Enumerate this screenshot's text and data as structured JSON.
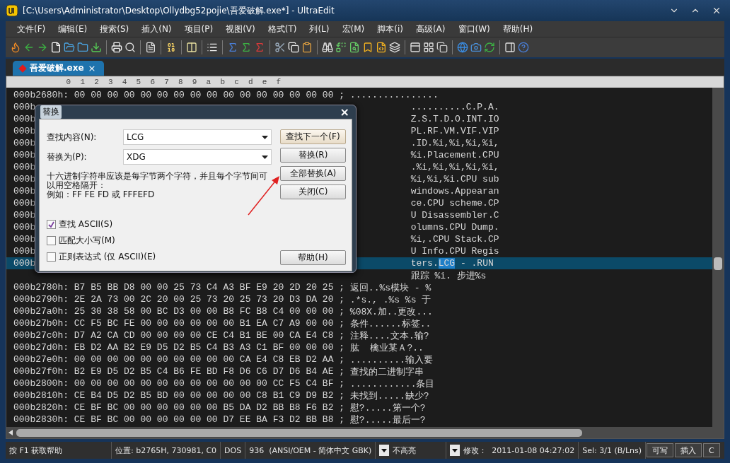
{
  "window": {
    "title": "[C:\\Users\\Administrator\\Desktop\\Ollydbg52pojie\\吾爱破解.exe*] - UltraEdit"
  },
  "menu": [
    "文件(F)",
    "编辑(E)",
    "搜索(S)",
    "插入(N)",
    "项目(P)",
    "视图(V)",
    "格式(T)",
    "列(L)",
    "宏(M)",
    "脚本(i)",
    "高级(A)",
    "窗口(W)",
    "帮助(H)"
  ],
  "tabs": [
    {
      "label": "吾爱破解.exe",
      "close": "×",
      "selected": true
    }
  ],
  "ruler": [
    "0",
    "1",
    "2",
    "3",
    "4",
    "5",
    "6",
    "7",
    "8",
    "9",
    "a",
    "b",
    "c",
    "d",
    "e",
    "f"
  ],
  "rows": [
    {
      "kind": "full",
      "selected": false,
      "address": "000b2680h:",
      "hex": "00 00 00 00 00 00 00 00 00 00 00 00 00 00 00 00",
      "separator": ";",
      "ascii": "................"
    },
    {
      "kind": "covered",
      "selected": false,
      "address": "000b",
      "ascii": "..........C.P.A."
    },
    {
      "kind": "covered",
      "selected": false,
      "address": "000b",
      "ascii": "Z.S.T.D.O.INT.IO"
    },
    {
      "kind": "covered",
      "selected": false,
      "address": "000b",
      "ascii": "PL.RF.VM.VIF.VIP"
    },
    {
      "kind": "covered",
      "selected": false,
      "address": "000b",
      "ascii": ".ID.%i,%i,%i,%i,"
    },
    {
      "kind": "covered",
      "selected": false,
      "address": "000b",
      "ascii": "%i.Placement.CPU"
    },
    {
      "kind": "covered",
      "selected": false,
      "address": "000b",
      "ascii": ".%i,%i,%i,%i,%i,"
    },
    {
      "kind": "covered",
      "selected": false,
      "address": "000b",
      "ascii": "%i,%i,%i.CPU sub"
    },
    {
      "kind": "covered",
      "selected": false,
      "address": "000b",
      "ascii": "windows.Appearan"
    },
    {
      "kind": "covered",
      "selected": false,
      "address": "000b",
      "ascii": "ce.CPU scheme.CP"
    },
    {
      "kind": "covered",
      "selected": false,
      "address": "000b",
      "ascii": "U Disassembler.C"
    },
    {
      "kind": "covered",
      "selected": false,
      "address": "000b",
      "ascii": "olumns.CPU Dump."
    },
    {
      "kind": "covered",
      "selected": false,
      "address": "000b",
      "ascii": "%i,.CPU Stack.CP"
    },
    {
      "kind": "covered",
      "selected": false,
      "address": "000b",
      "ascii": "U Info.CPU Regis"
    },
    {
      "kind": "covered",
      "selected": true,
      "address": "000b",
      "ascii_parts": [
        {
          "text": "ters.",
          "selected": false
        },
        {
          "text": "LCG",
          "selected": true
        },
        {
          "text": " - .RUN",
          "selected": false
        }
      ]
    },
    {
      "kind": "covered",
      "selected": false,
      "ascii": "跟踪 %i. 步进%s"
    },
    {
      "kind": "full",
      "selected": false,
      "address": "000b2780h:",
      "hex": "B7 B5 BB D8 00 00 25 73 C4 A3 BF E9 20 2D 20 25",
      "separator": ";",
      "ascii": "返回..%s模块 - %"
    },
    {
      "kind": "full",
      "selected": false,
      "address": "000b2790h:",
      "hex": "2E 2A 73 00 2C 20 00 25 73 20 25 73 20 D3 DA 20",
      "separator": ";",
      "ascii": ".*s., .%s %s 于"
    },
    {
      "kind": "full",
      "selected": false,
      "address": "000b27a0h:",
      "hex": "25 30 38 58 00 BC D3 00 00 B8 FC B8 C4 00 00 00",
      "separator": ";",
      "ascii": "%08X.加..更改..."
    },
    {
      "kind": "full",
      "selected": false,
      "address": "000b27b0h:",
      "hex": "CC F5 BC FE 00 00 00 00 00 00 B1 EA C7 A9 00 00",
      "separator": ";",
      "ascii": "条件......标签.."
    },
    {
      "kind": "full",
      "selected": false,
      "address": "000b27c0h:",
      "hex": "D7 A2 CA CD 00 00 00 00 CE C4 B1 BE 00 CA E4 C8",
      "separator": ";",
      "ascii": "注释....文本.输?"
    },
    {
      "kind": "full",
      "selected": false,
      "address": "000b27d0h:",
      "hex": "EB D2 AA B2 E9 D5 D2 B5 C4 B3 A3 C1 BF 00 00 00",
      "separator": ";",
      "ascii": "肱  檎业某Ａ?.."
    },
    {
      "kind": "full",
      "selected": false,
      "address": "000b27e0h:",
      "hex": "00 00 00 00 00 00 00 00 00 00 CA E4 C8 EB D2 AA",
      "separator": ";",
      "ascii": "..........输入要"
    },
    {
      "kind": "full",
      "selected": false,
      "address": "000b27f0h:",
      "hex": "B2 E9 D5 D2 B5 C4 B6 FE BD F8 D6 C6 D7 D6 B4 AE",
      "separator": ";",
      "ascii": "查找的二进制字串"
    },
    {
      "kind": "full",
      "selected": false,
      "address": "000b2800h:",
      "hex": "00 00 00 00 00 00 00 00 00 00 00 00 CC F5 C4 BF",
      "separator": ";",
      "ascii": "............条目"
    },
    {
      "kind": "full",
      "selected": false,
      "address": "000b2810h:",
      "hex": "CE B4 D5 D2 B5 BD 00 00 00 00 00 C8 B1 C9 D9 B2",
      "separator": ";",
      "ascii": "未找到.....缺少?"
    },
    {
      "kind": "full",
      "selected": false,
      "address": "000b2820h:",
      "hex": "CE BF BC 00 00 00 00 00 00 B5 DA D2 BB B8 F6 B2",
      "separator": ";",
      "ascii": "慰?.....第一个?"
    },
    {
      "kind": "full",
      "selected": false,
      "address": "000b2830h:",
      "hex": "CE BF BC 00 00 00 00 00 00 D7 EE BA F3 D2 BB B8",
      "separator": ";",
      "ascii": "慰?.....最后一?"
    }
  ],
  "dialog": {
    "title": "替换",
    "close": "×",
    "fields": [
      {
        "label": "查找内容(N):",
        "value": "LCG"
      },
      {
        "label": "替换为(P):",
        "value": "XDG"
      }
    ],
    "hint": "十六进制字符串应该是每字节两个字符，并且每个字节间可以用空格隔开：",
    "example": "例如：FF FE FD 或 FFFEFD",
    "checkboxes": [
      {
        "label": "查找 ASCII(S)",
        "checked": true
      },
      {
        "label": "匹配大小写(M)",
        "checked": false
      },
      {
        "label": "正则表达式 (仅 ASCII)(E)",
        "checked": false
      }
    ],
    "buttons": [
      {
        "label": "查找下一个(F)",
        "default": true
      },
      {
        "label": "替换(R)",
        "default": false
      },
      {
        "label": "全部替换(A)",
        "default": false
      },
      {
        "label": "关闭(C)",
        "default": false
      }
    ],
    "help_button": "帮助(H)"
  },
  "status_bar": [
    {
      "kind": "text",
      "text": "按 F1 获取帮助"
    },
    {
      "kind": "text",
      "text": "位置: b2765H, 730981, C0"
    },
    {
      "kind": "text",
      "text": "DOS"
    },
    {
      "kind": "text",
      "text": "936  (ANSI/OEM - 简体中文 GBK)"
    },
    {
      "kind": "dropdown",
      "text": "不高亮"
    },
    {
      "kind": "dropdown",
      "text": "修改：  2011-01-08 04:27:02"
    },
    {
      "kind": "text",
      "text": "Sel: 3/1 (B/Lns)"
    },
    {
      "kind": "button",
      "text": "可写"
    },
    {
      "kind": "button",
      "text": "插入"
    },
    {
      "kind": "button",
      "text": "C"
    }
  ]
}
